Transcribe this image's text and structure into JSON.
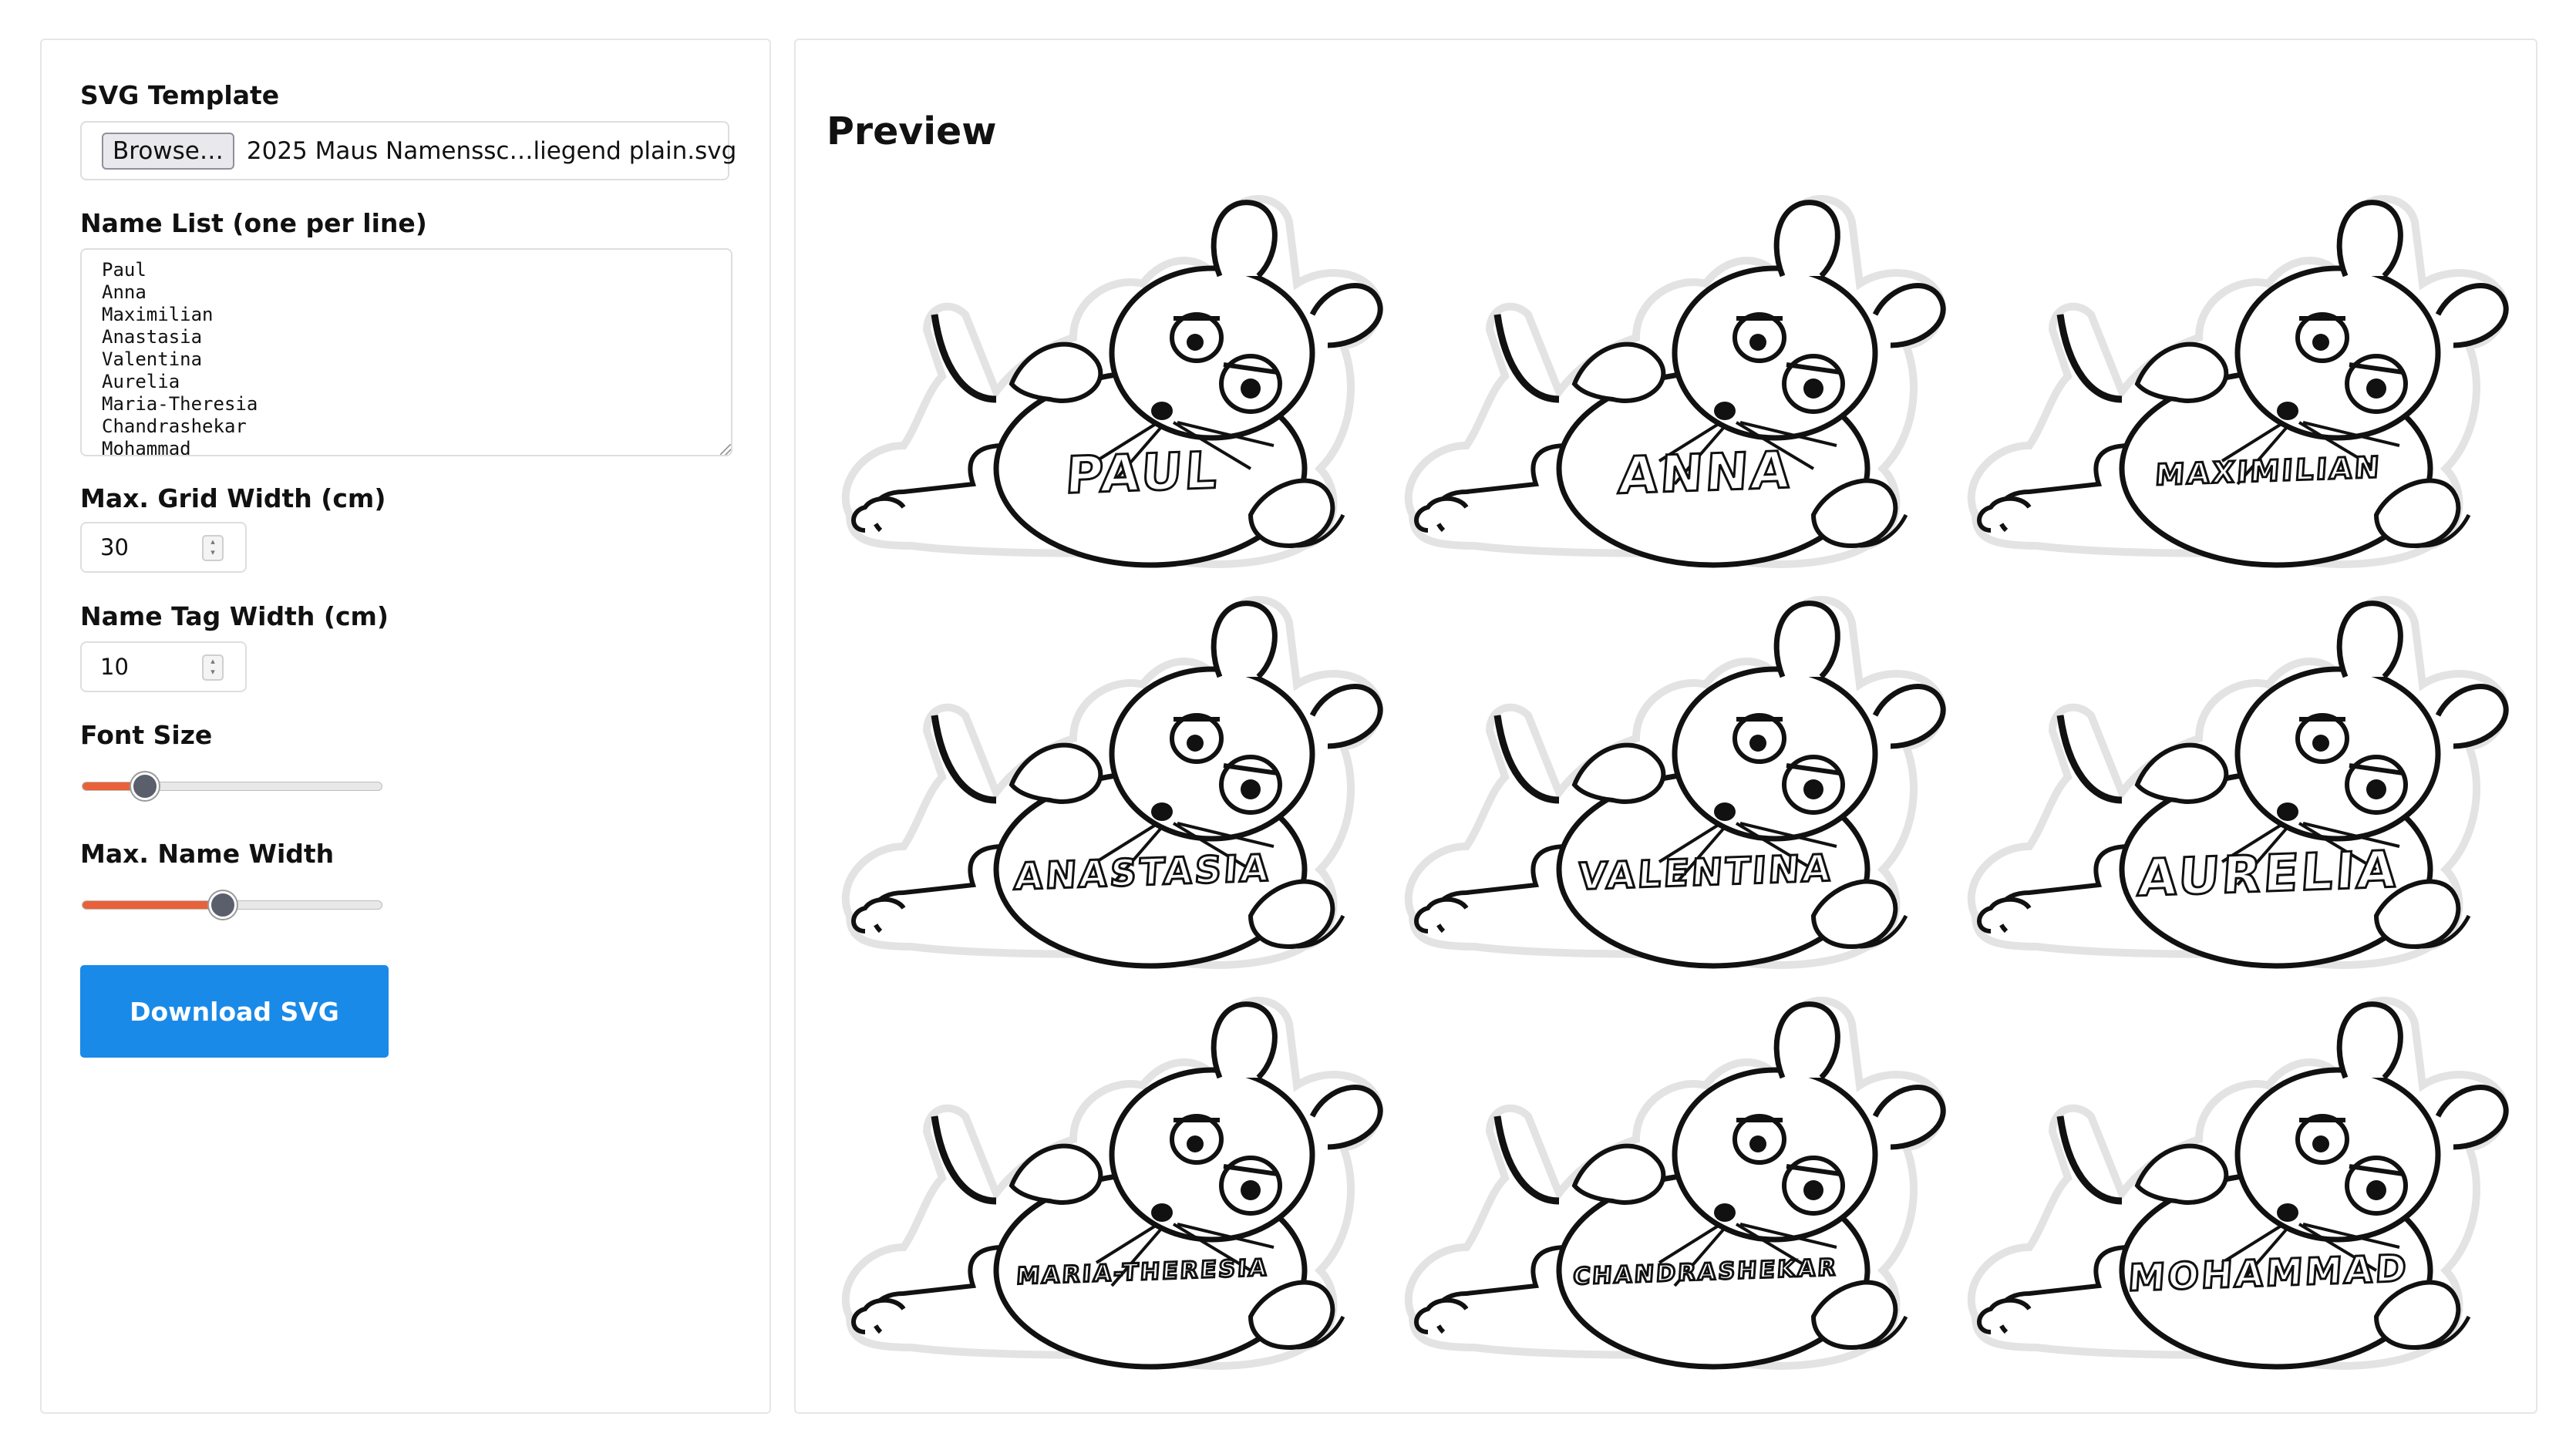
{
  "sidebar": {
    "svg_template_label": "SVG Template",
    "browse_label": "Browse…",
    "file_name": "2025 Maus Namenssc…liegend plain.svg",
    "name_list_label": "Name List (one per line)",
    "names_text": "Paul\nAnna\nMaximilian\nAnastasia\nValentina\nAurelia\nMaria-Theresia\nChandrashekar\nMohammad",
    "grid_width_label": "Max. Grid Width (cm)",
    "grid_width_value": "30",
    "tag_width_label": "Name Tag Width (cm)",
    "tag_width_value": "10",
    "font_size_label": "Font Size",
    "font_size_fraction": 0.21,
    "max_name_width_label": "Max. Name Width",
    "max_name_width_fraction": 0.47,
    "download_label": "Download SVG"
  },
  "preview": {
    "title": "Preview",
    "tags": [
      {
        "name": "PAUL",
        "size": "large"
      },
      {
        "name": "ANNA",
        "size": "large"
      },
      {
        "name": "MAXIMILIAN",
        "size": "small"
      },
      {
        "name": "ANASTASIA",
        "size": "medium"
      },
      {
        "name": "VALENTINA",
        "size": "medium"
      },
      {
        "name": "AURELIA",
        "size": "large"
      },
      {
        "name": "MARIA-THERESIA",
        "size": "tiny"
      },
      {
        "name": "CHANDRASHEKAR",
        "size": "tiny"
      },
      {
        "name": "MOHAMMAD",
        "size": "medium"
      }
    ]
  },
  "colors": {
    "accent_slider": "#e8613a",
    "download_button": "#1a8ae8",
    "thumb": "#5a5f6b"
  }
}
